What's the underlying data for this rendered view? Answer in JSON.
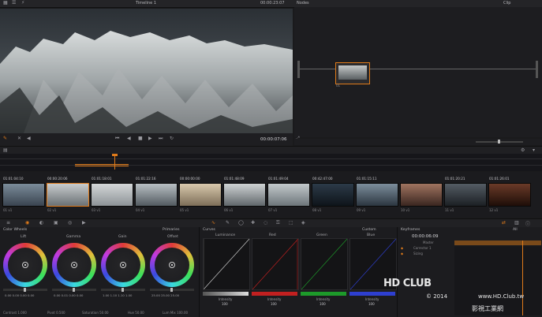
{
  "topbar": {
    "timeline": "Timeline 1",
    "timecode": "00:00:23:07",
    "nodes_title": "Nodes",
    "clip_label": "Clip"
  },
  "transport": {
    "timecode": "00:00:07:06"
  },
  "clips": [
    {
      "tc": "01:01:04:10",
      "n": "01",
      "c": "v1"
    },
    {
      "tc": "00:00:20:06",
      "n": "02",
      "c": "v1"
    },
    {
      "tc": "01:01:18:01",
      "n": "03",
      "c": "v1"
    },
    {
      "tc": "01:01:22:16",
      "n": "04",
      "c": "v1"
    },
    {
      "tc": "00:00:00:00",
      "n": "05",
      "c": "v1"
    },
    {
      "tc": "01:01:48:09",
      "n": "06",
      "c": "v1"
    },
    {
      "tc": "01:01:49:04",
      "n": "07",
      "c": "v1"
    },
    {
      "tc": "00:42:47:00",
      "n": "08",
      "c": "v1"
    },
    {
      "tc": "01:01:15:11",
      "n": "09",
      "c": "v1"
    },
    {
      "tc": "",
      "n": "10",
      "c": "v1"
    },
    {
      "tc": "01:01:20:21",
      "n": "11",
      "c": "v1"
    },
    {
      "tc": "01:01:26:01",
      "n": "12",
      "c": "v1"
    }
  ],
  "wheels_panel": {
    "title": "Color Wheels",
    "mode": "Primaries",
    "wheels": [
      {
        "name": "Lift",
        "vals": "0.00  0.00  0.00  0.00"
      },
      {
        "name": "Gamma",
        "vals": "0.00  0.01  0.00  0.00"
      },
      {
        "name": "Gain",
        "vals": "1.00  1.10  1.10  1.00"
      },
      {
        "name": "Offset",
        "vals": "25.00  25.00  25.00"
      }
    ],
    "footer": [
      "Contrast 1.000",
      "Pivot 0.500",
      "Saturation 50.00",
      "Hue 50.00",
      "Lum Mix 100.00"
    ]
  },
  "curves_panel": {
    "title": "Curves",
    "mode": "Custom",
    "curves": [
      {
        "name": "Luminance",
        "intensity": "100"
      },
      {
        "name": "Red",
        "intensity": "100"
      },
      {
        "name": "Green",
        "intensity": "100"
      },
      {
        "name": "Blue",
        "intensity": "100"
      }
    ],
    "intensity_label": "Intensity"
  },
  "keyframes_panel": {
    "title": "Keyframes",
    "filter": "All",
    "timecode": "00:00:06:09",
    "tracks": [
      "Master",
      "Corrector 1",
      "Sizing"
    ]
  },
  "watermark": {
    "line1": "HD CLUB",
    "line2": "© 2014",
    "site": "www.HD.Club.tw",
    "brand": "影視工業網"
  },
  "colors": {
    "accent": "#e07b1a",
    "red": "#c22020",
    "green": "#1d9a2a",
    "blue": "#2e3fd0"
  }
}
